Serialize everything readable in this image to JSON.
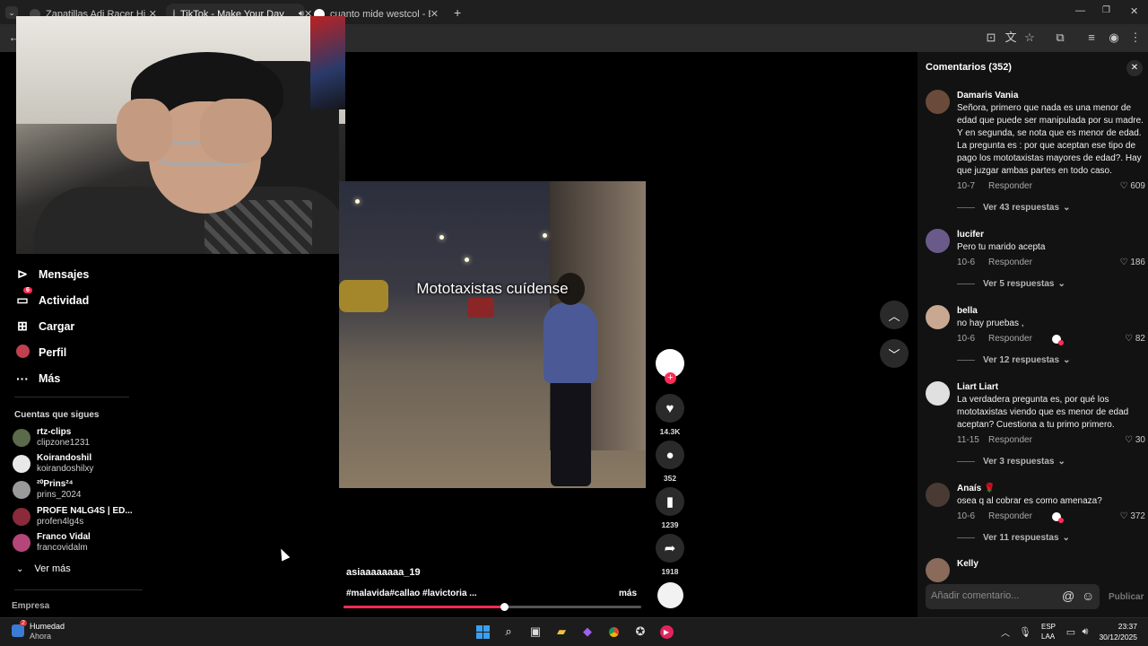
{
  "browser": {
    "tabs": [
      {
        "title": "Zapatillas Adi Racer Hi - Azul a",
        "favicon_color": "#222222"
      },
      {
        "title": "TikTok - Make Your Day",
        "favicon_color": "#000000"
      },
      {
        "title": "cuanto mide westcol - Buscar c",
        "favicon_color": "#4285f4"
      }
    ],
    "new_tab_label": "+"
  },
  "sidebar": {
    "items": [
      {
        "label": "Mensajes",
        "icon": "send-icon",
        "glyph": "⊳"
      },
      {
        "label": "Actividad",
        "icon": "inbox-icon",
        "glyph": "▭",
        "badge": "6"
      },
      {
        "label": "Cargar",
        "icon": "upload-icon",
        "glyph": "⊞"
      },
      {
        "label": "Perfil",
        "icon": "profile-icon",
        "glyph": "●"
      },
      {
        "label": "Más",
        "icon": "more-icon",
        "glyph": "···"
      }
    ],
    "following_title": "Cuentas que sigues",
    "following": [
      {
        "name": "rtz-clips",
        "handle": "clipzone1231",
        "color": "#5b6a4a"
      },
      {
        "name": "Koirandoshil",
        "handle": "koirandoshilxy",
        "color": "#e8e8e8"
      },
      {
        "name": "²⁰Prins²⁴",
        "handle": "prins_2024",
        "color": "#9a9a9a"
      },
      {
        "name": "PROFE N4LG4S | ED...",
        "handle": "profen4lg4s",
        "color": "#8a2a3a"
      },
      {
        "name": "Franco Vidal",
        "handle": "francovidalm",
        "color": "#b5467a"
      }
    ],
    "see_more": "Ver más",
    "footer": "Empresa"
  },
  "video": {
    "overlay_text": "Mototaxistas cuídense",
    "author": "asiaaaaaaaa_19",
    "tags": "#malavida#callao #lavictoria ...",
    "more": "más",
    "progress": 0.54
  },
  "actions": {
    "likes": "14.3K",
    "comments": "352",
    "saves": "1239",
    "shares": "1918"
  },
  "comments_panel": {
    "title": "Comentarios (352)",
    "reply_label": "Responder",
    "placeholder": "Añadir comentario...",
    "publish": "Publicar",
    "items": [
      {
        "user": "Damaris Vania",
        "text": "Señora, primero que nada es una menor de edad que puede ser manipulada por su madre. Y en segunda, se nota que es menor de edad. La pregunta es : por que aceptan ese tipo de pago los mototaxistas mayores de edad?. Hay que juzgar ambas partes en todo caso.",
        "date": "10-7",
        "likes": "609",
        "replies": "Ver 43 respuestas",
        "color": "#6a4a3a"
      },
      {
        "user": "lucifer",
        "text": "Pero tu marido acepta",
        "date": "10-6",
        "likes": "186",
        "replies": "Ver 5 respuestas",
        "color": "#6a5a8a"
      },
      {
        "user": "bella",
        "text": "no hay pruebas ,",
        "date": "10-6",
        "likes": "82",
        "replies": "Ver 12 respuestas",
        "color": "#c8a890"
      },
      {
        "user": "Liart Liart",
        "text": "La verdadera pregunta es, por qué los mototaxistas viendo que es menor de edad aceptan? Cuestiona a tu primo primero.",
        "date": "11-15",
        "likes": "30",
        "replies": "Ver 3 respuestas",
        "color": "#e0e0e0"
      },
      {
        "user": "Anaís 🌹",
        "text": "osea q al cobrar es como amenaza?",
        "date": "10-6",
        "likes": "372",
        "replies": "Ver 11 respuestas",
        "color": "#4a3a34"
      },
      {
        "user": "Kelly",
        "text": "",
        "color": "#8a6a5a"
      }
    ]
  },
  "taskbar": {
    "weather_title": "Humedad",
    "weather_sub": "Ahora",
    "weather_badge": "2",
    "lang1": "ESP",
    "lang2": "LAA",
    "time": "23:37",
    "date": "30/12/2025"
  }
}
